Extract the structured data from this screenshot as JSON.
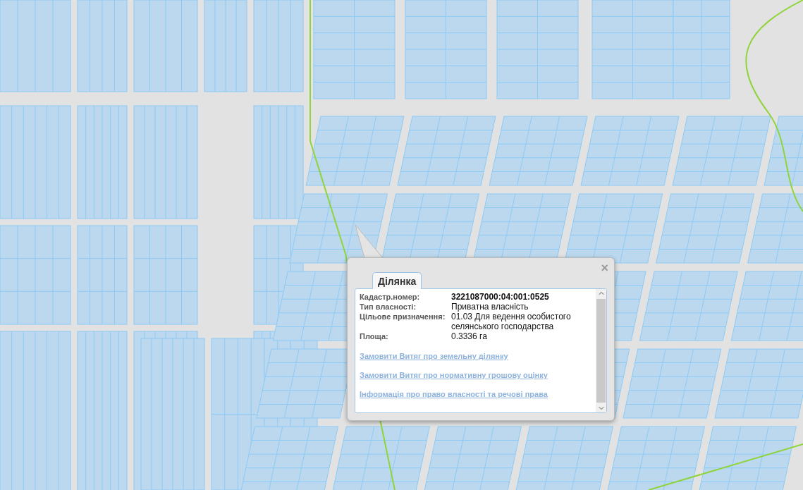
{
  "popup": {
    "close": "×",
    "tabs": [
      {
        "label": "Ділянка",
        "selected": true
      }
    ],
    "fields": [
      {
        "label": "Кадастр.номер:",
        "value": "3221087000:04:001:0525",
        "kind": "id"
      },
      {
        "label": "Тип власності:",
        "value": "Приватна власність",
        "kind": "text"
      },
      {
        "label": "Цільове призначення:",
        "value": "01.03 Для ведення особистого селянського господарства",
        "kind": "text"
      },
      {
        "label": "Площа:",
        "value": "0.3336 га",
        "kind": "text"
      }
    ],
    "links": [
      "Замовити Витяг про земельну ділянку",
      "Замовити Витяг про нормативну грошову оцінку",
      "Інформація про право власності та речові права"
    ]
  }
}
